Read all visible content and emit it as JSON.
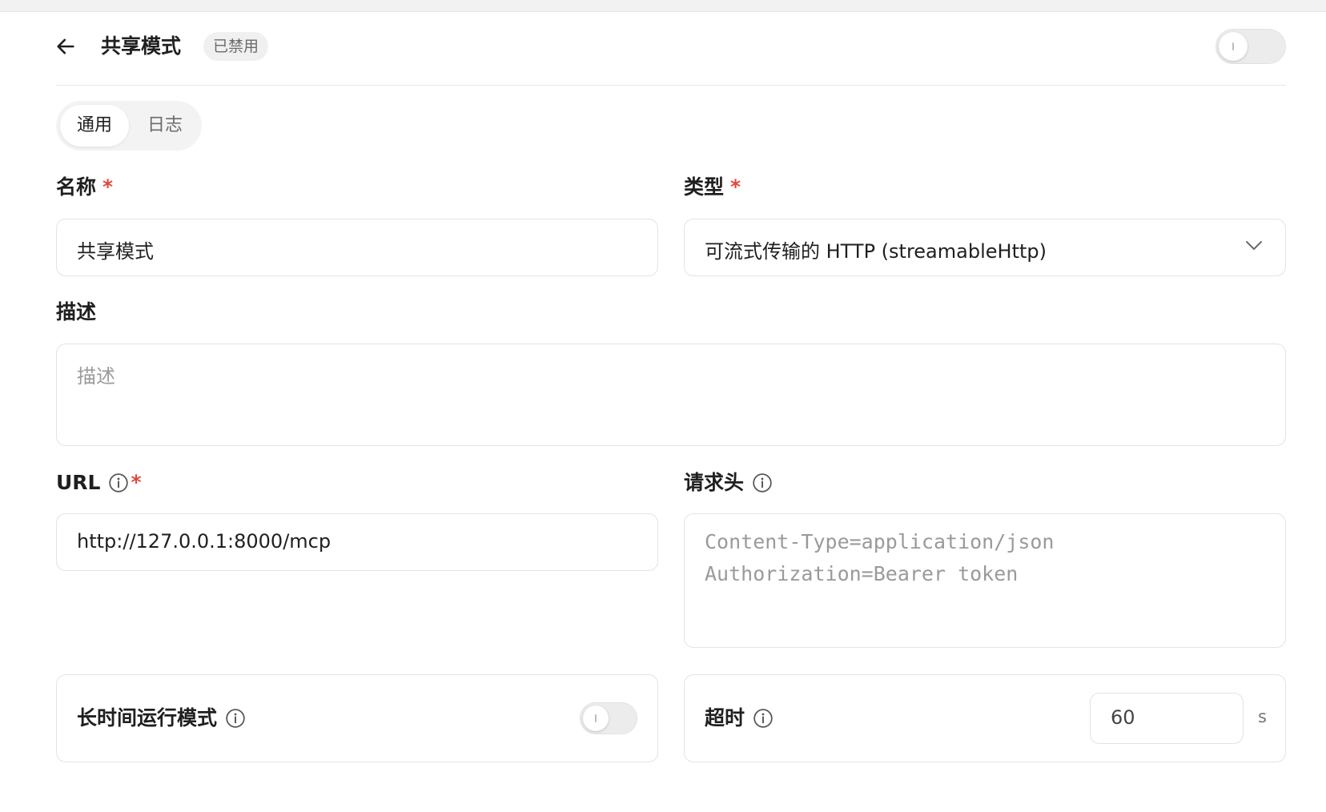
{
  "header": {
    "title": "共享模式",
    "status_badge": "已禁用",
    "enabled": false
  },
  "tabs": [
    {
      "label": "通用",
      "active": true
    },
    {
      "label": "日志",
      "active": false
    }
  ],
  "form": {
    "name": {
      "label": "名称",
      "required_mark": "*",
      "value": "共享模式"
    },
    "type": {
      "label": "类型",
      "required_mark": "*",
      "selected": "可流式传输的 HTTP (streamableHttp)"
    },
    "description": {
      "label": "描述",
      "placeholder": "描述"
    },
    "url": {
      "label": "URL",
      "required_mark": "*",
      "value": "http://127.0.0.1:8000/mcp"
    },
    "headers": {
      "label": "请求头",
      "placeholder_line1": "Content-Type=application/json",
      "placeholder_line2": "Authorization=Bearer token"
    },
    "long_running": {
      "label": "长时间运行模式",
      "enabled": false
    },
    "timeout": {
      "label": "超时",
      "value": "60",
      "unit": "s"
    }
  },
  "colors": {
    "required": "#e0463c",
    "border": "#e3e3e5",
    "toggle_off": "#ececec"
  }
}
